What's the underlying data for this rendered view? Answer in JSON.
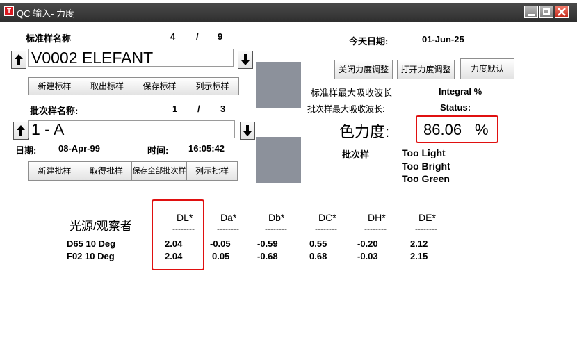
{
  "window": {
    "title": "QC 输入- 力度",
    "app_icon": "T",
    "accent_color": "#d71920"
  },
  "standard": {
    "label": "标准样名称",
    "index": "4",
    "sep": "/",
    "total": "9",
    "name": "V0002 ELEFANT",
    "buttons": [
      "新建标样",
      "取出标样",
      "保存标样",
      "列示标样"
    ]
  },
  "batch": {
    "label": "批次样名称:",
    "index": "1",
    "sep": "/",
    "total": "3",
    "name": "1 - A",
    "date_label": "日期:",
    "date_value": "08-Apr-99",
    "time_label": "时间:",
    "time_value": "16:05:42",
    "buttons": [
      "新建批样",
      "取得批样",
      "保存全部批次样",
      "列示批样"
    ]
  },
  "today": {
    "label": "今天日期:",
    "value": "01-Jun-25"
  },
  "strength_buttons": [
    "关闭力度调整",
    "打开力度调整",
    "力度默认"
  ],
  "std_max_wl": {
    "label": "标准样最大吸收波长",
    "value": "Integral %"
  },
  "batch_max_wl": {
    "label": "批次样最大吸收波长:",
    "value": "Status:"
  },
  "strength": {
    "label": "色力度:",
    "value": "86.06",
    "unit": "%"
  },
  "assessment": {
    "label": "批次样",
    "lines": [
      "Too Light",
      "Too Bright",
      "Too Green"
    ]
  },
  "table": {
    "row_header": "光源/观察者",
    "columns": [
      "DL*",
      "Da*",
      "Db*",
      "DC*",
      "DH*",
      "DE*"
    ],
    "separator": "--------",
    "rows": [
      {
        "label": "D65 10 Deg",
        "values": [
          "2.04",
          "-0.05",
          "-0.59",
          "0.55",
          "-0.20",
          "2.12"
        ]
      },
      {
        "label": "F02 10 Deg",
        "values": [
          "2.04",
          "0.05",
          "-0.68",
          "0.68",
          "-0.03",
          "2.15"
        ]
      }
    ]
  },
  "colors": {
    "swatch": "#8c919b",
    "highlight_border": "#e01010"
  }
}
